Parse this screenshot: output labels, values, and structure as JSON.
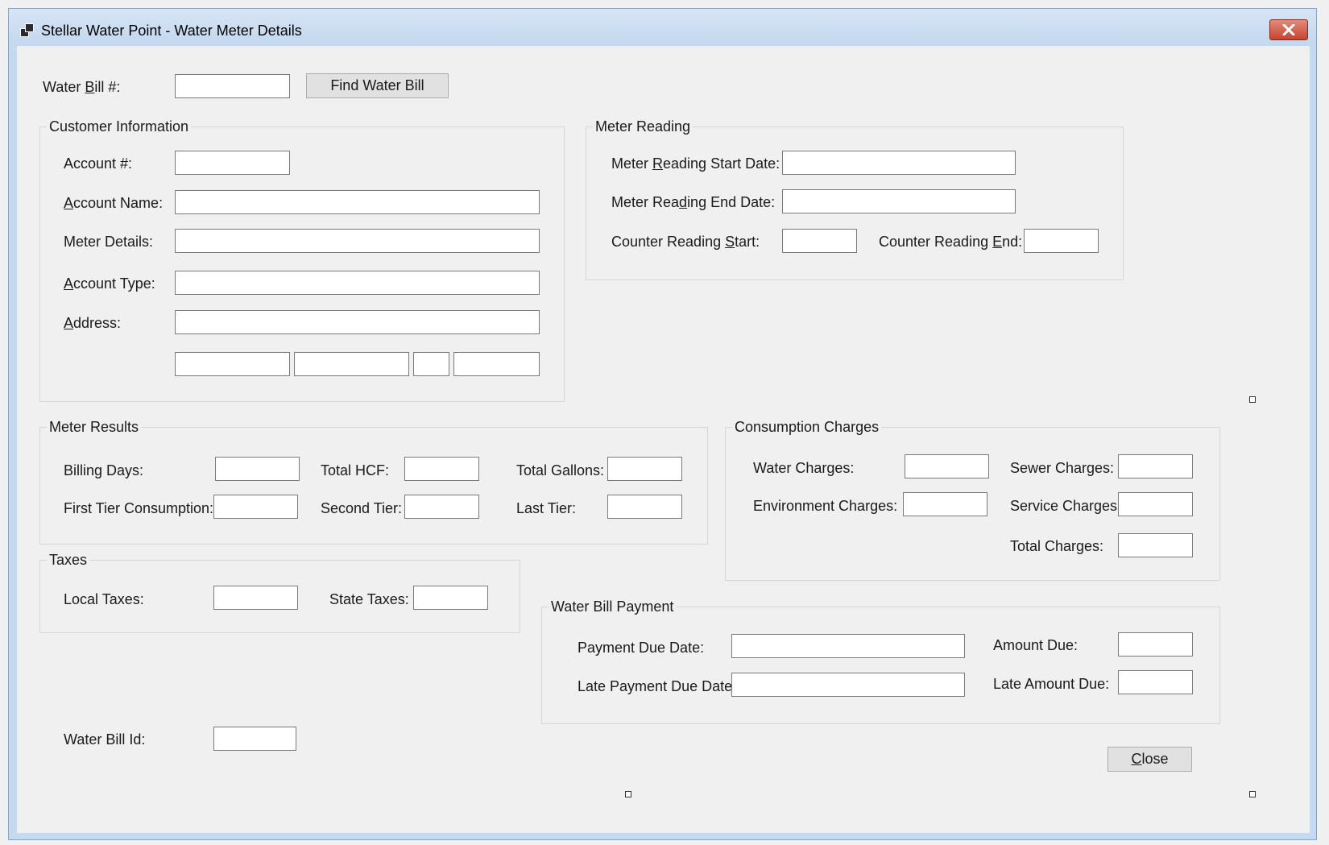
{
  "window": {
    "title": "Stellar Water Point - Water Meter Details"
  },
  "search": {
    "water_bill_label": "Water Bill #:",
    "find_button": "Find Water Bill"
  },
  "customer": {
    "group_title": "Customer Information",
    "account_number_label": "Account #:",
    "account_name_label": "Account Name:",
    "meter_details_label": "Meter Details:",
    "account_type_label": "Account Type:",
    "address_label": "Address:"
  },
  "meter_reading": {
    "group_title": "Meter Reading",
    "start_date_label": "Meter Reading Start Date:",
    "end_date_label": "Meter Reading End Date:",
    "counter_start_label": "Counter Reading Start:",
    "counter_end_label": "Counter Reading End:"
  },
  "meter_results": {
    "group_title": "Meter Results",
    "billing_days_label": "Billing Days:",
    "total_hcf_label": "Total HCF:",
    "total_gallons_label": "Total Gallons:",
    "first_tier_label": "First Tier Consumption:",
    "second_tier_label": "Second Tier:",
    "last_tier_label": "Last Tier:"
  },
  "consumption": {
    "group_title": "Consumption Charges",
    "water_charges_label": "Water Charges:",
    "sewer_charges_label": "Sewer Charges:",
    "environment_charges_label": "Environment Charges:",
    "service_charges_label": "Service Charges:",
    "total_charges_label": "Total Charges:"
  },
  "taxes": {
    "group_title": "Taxes",
    "local_taxes_label": "Local Taxes:",
    "state_taxes_label": "State Taxes:"
  },
  "payment": {
    "group_title": "Water Bill Payment",
    "due_date_label": "Payment Due Date:",
    "amount_due_label": "Amount Due:",
    "late_due_date_label": "Late Payment Due Date:",
    "late_amount_label": "Late Amount Due:"
  },
  "footer": {
    "water_bill_id_label": "Water Bill Id:",
    "close_button": "Close"
  }
}
